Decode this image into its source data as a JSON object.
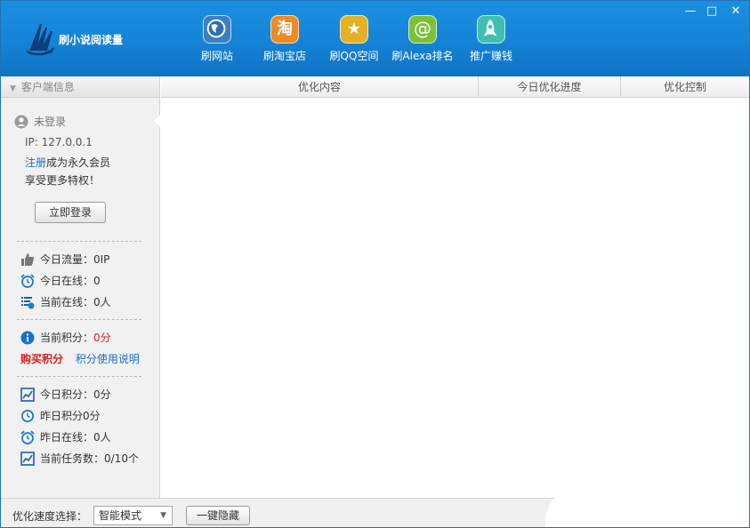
{
  "app": {
    "title": "刷小说阅读量"
  },
  "nav": [
    {
      "label": "刷网站",
      "icon": "globe-icon",
      "color": "#3c7fc2"
    },
    {
      "label": "刷淘宝店",
      "icon": "taobao-icon",
      "color": "#f08a24",
      "glyph": "淘"
    },
    {
      "label": "刷QQ空间",
      "icon": "star-icon",
      "color": "#e2b126",
      "glyph": "★"
    },
    {
      "label": "刷Alexa排名",
      "icon": "alexa-icon",
      "color": "#7cc13a",
      "glyph": "@"
    },
    {
      "label": "推广赚钱",
      "icon": "rocket-icon",
      "color": "#3fbfb1"
    }
  ],
  "window_controls": {
    "minimize": "—",
    "maximize": "□",
    "close": "✕"
  },
  "sidebar": {
    "header": "客户端信息",
    "user_status": "未登录",
    "ip": "IP: 127.0.0.1",
    "register_link": "注册",
    "register_text": "成为永久会员",
    "privilege_text": "享受更多特权！",
    "login_button": "立即登录",
    "stats1": [
      {
        "icon": "thumbs-up-icon",
        "label": "今日流量：0IP"
      },
      {
        "icon": "alarm-clock-icon",
        "label": "今日在线：0"
      },
      {
        "icon": "online-list-icon",
        "label": "当前在线：0人"
      }
    ],
    "points": {
      "label": "当前积分：",
      "value": "0分"
    },
    "buy_points": "购买积分",
    "points_help": "积分使用说明",
    "stats2": [
      {
        "icon": "chart-icon",
        "label": "今日积分：0分"
      },
      {
        "icon": "clock-icon",
        "label": "昨日积分0分"
      },
      {
        "icon": "alarm-clock-icon",
        "label": "昨日在线：0人"
      },
      {
        "icon": "chart-icon",
        "label": "当前任务数：0/10个"
      }
    ]
  },
  "table": {
    "columns": [
      "优化内容",
      "今日优化进度",
      "优化控制"
    ],
    "rows": []
  },
  "footer": {
    "speed_label": "优化速度选择：",
    "speed_mode": "智能模式",
    "hide_button": "一键隐藏"
  }
}
